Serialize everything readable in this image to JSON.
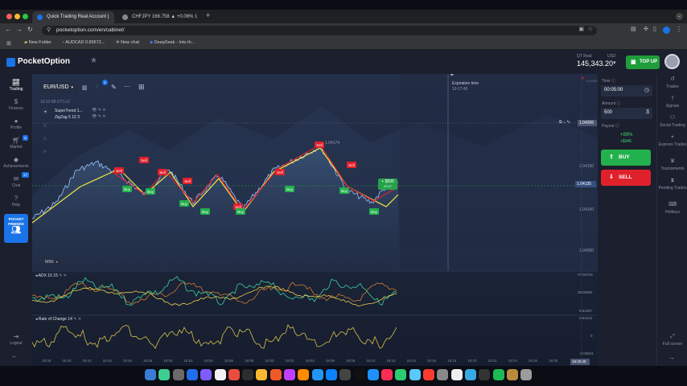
{
  "browser": {
    "tabs": [
      {
        "label": "Quick Trading Real Account |",
        "active": true
      },
      {
        "label": "CHFJPY 166.758 ▲ +0.06% 1",
        "active": false
      }
    ],
    "new_tab_glyph": "+",
    "url": "pocketoption.com/en/cabinet/",
    "bookmarks": [
      "New Folder",
      "AUDCAD 0.89672...",
      "New chat",
      "DeepSeek - Into th..."
    ]
  },
  "header": {
    "logo_text": "PocketOption",
    "account_type": "QT Real",
    "currency": "USD",
    "balance": "145,343.20",
    "top_up_label": "TOP UP"
  },
  "sidebar_left": {
    "items": [
      {
        "label": "Trading",
        "icon": "chart-icon"
      },
      {
        "label": "Finance",
        "icon": "dollar-icon"
      },
      {
        "label": "Profile",
        "icon": "user-icon"
      },
      {
        "label": "Market",
        "icon": "cart-icon"
      },
      {
        "label": "Achievements",
        "icon": "diamond-icon"
      },
      {
        "label": "Chat",
        "icon": "chat-icon"
      },
      {
        "label": "Help",
        "icon": "help-icon"
      }
    ],
    "friends_label_1": "POCKET",
    "friends_label_2": "FRIENDS",
    "logout_label": "Logout",
    "badge_market": "6",
    "badge_chat": "17"
  },
  "toolbar": {
    "asset": "EUR/USD",
    "timeframe": "M56",
    "time": "19:12:48 UTC+2",
    "badge": "1"
  },
  "indicators": [
    "SuperTrend 1...",
    "ZigZag 5 12 3"
  ],
  "chart": {
    "price_labels": [
      "1.04150",
      "1.04135",
      "1.04100",
      "1.04050"
    ],
    "current_price": "1.04135",
    "hover_price": "1.04206",
    "peak_label": "1.04174",
    "expiration_label": "Expiration time",
    "expiration_time": "19:17:45",
    "trade_badge": "+ $500",
    "trade_badge_sub": "00:57",
    "x_labels": [
      "18:38",
      "18:40",
      "18:42",
      "18:44",
      "18:46",
      "18:48",
      "18:50",
      "18:52",
      "18:54",
      "18:56",
      "18:58",
      "19:00",
      "19:02",
      "19:04",
      "19:06",
      "19:08",
      "19:10",
      "19:12",
      "19:14",
      "19:16",
      "19:18",
      "19:20",
      "19:22",
      "19:24",
      "19:26",
      "19:28"
    ],
    "x_cursor": "19:30:45",
    "signals": [
      {
        "type": "Sell"
      },
      {
        "type": "Buy"
      },
      {
        "type": "Sell"
      },
      {
        "type": "Buy"
      },
      {
        "type": "Sell"
      },
      {
        "type": "Buy"
      },
      {
        "type": "Sell"
      },
      {
        "type": "Buy"
      },
      {
        "type": "Sell"
      },
      {
        "type": "Buy"
      },
      {
        "type": "Sell"
      },
      {
        "type": "Buy"
      },
      {
        "type": "Sell"
      },
      {
        "type": "Buy"
      },
      {
        "type": "Sell"
      },
      {
        "type": "Buy"
      }
    ]
  },
  "adx": {
    "label": "ADX 15 15",
    "scale": [
      "47.50724",
      "28.50891",
      "9.51057"
    ]
  },
  "roc": {
    "label": "Rate of Change 14",
    "scale": [
      "0.04131",
      "0",
      "-0.03841"
    ]
  },
  "trade_panel": {
    "time_label": "Time",
    "time_value": "00:05:00",
    "amount_label": "Amount",
    "amount_value": "500",
    "payout_label": "Payout",
    "payout_percent": "+89%",
    "payout_value": "+$945",
    "buy_label": "BUY",
    "sell_label": "SELL"
  },
  "sidebar_right": {
    "items": [
      "Trades",
      "Signals",
      "Social Trading",
      "Express Trades",
      "Tournaments",
      "Pending Trades",
      "Hotkeys"
    ],
    "fullscreen_label": "Full screen"
  },
  "colors": {
    "buy": "#23b14d",
    "sell": "#e0212b",
    "accent": "#1a73e8",
    "supertrend": "#f5e642"
  }
}
